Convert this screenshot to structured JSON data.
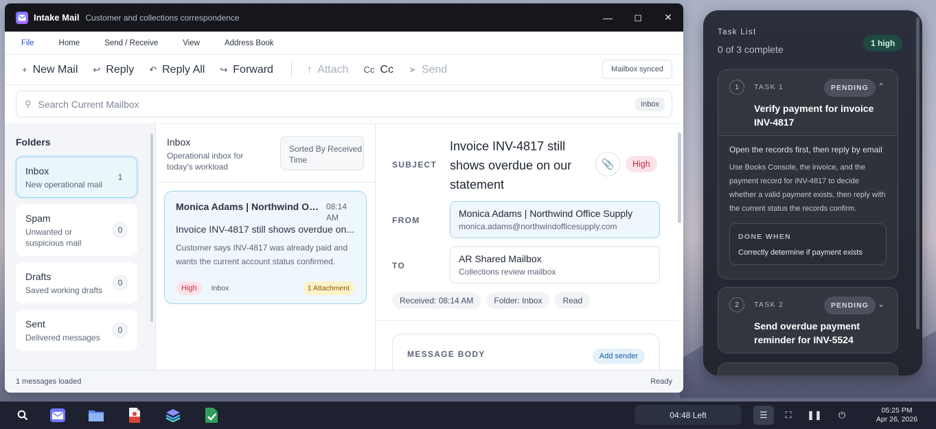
{
  "window": {
    "title": "Intake Mail",
    "subtitle": "Customer and collections correspondence"
  },
  "menu": [
    "File",
    "Home",
    "Send / Receive",
    "View",
    "Address Book"
  ],
  "toolbar": {
    "new_mail": "New Mail",
    "reply": "Reply",
    "reply_all": "Reply All",
    "forward": "Forward",
    "attach": "Attach",
    "cc": "Cc",
    "cc_icon_text": "Cc",
    "send": "Send",
    "status": "Mailbox synced"
  },
  "search": {
    "placeholder": "Search Current Mailbox",
    "scope": "Inbox"
  },
  "folders": {
    "heading": "Folders",
    "items": [
      {
        "name": "Inbox",
        "desc": "New operational mail",
        "count": "1"
      },
      {
        "name": "Spam",
        "desc": "Unwanted or suspicious mail",
        "count": "0"
      },
      {
        "name": "Drafts",
        "desc": "Saved working drafts",
        "count": "0"
      },
      {
        "name": "Sent",
        "desc": "Delivered messages",
        "count": "0"
      }
    ]
  },
  "list": {
    "title": "Inbox",
    "desc": "Operational inbox for today's workload",
    "sort": "Sorted By Received Time",
    "messages": [
      {
        "from": "Monica Adams | Northwind Of...",
        "time": "08:14 AM",
        "subject": "Invoice INV-4817 still shows overdue on...",
        "preview": "Customer says INV-4817 was already paid and wants the current account status confirmed.",
        "priority": "High",
        "folder": "Inbox",
        "attachments": "1 Attachment"
      }
    ]
  },
  "reader": {
    "subject_label": "SUBJECT",
    "subject": "Invoice INV-4817 still shows overdue on our statement",
    "priority": "High",
    "from_label": "FROM",
    "from_name": "Monica Adams | Northwind Office Supply",
    "from_email": "monica.adams@northwindofficesupply.com",
    "to_label": "TO",
    "to_name": "AR Shared Mailbox",
    "to_desc": "Collections review mailbox",
    "meta": [
      "Received: 08:14 AM",
      "Folder: Inbox",
      "Read"
    ],
    "body_label": "MESSAGE BODY",
    "add_sender": "Add sender"
  },
  "status": {
    "left": "1 messages loaded",
    "right": "Ready"
  },
  "tasks": {
    "heading": "Task List",
    "progress": "0 of 3 complete",
    "badge": "1 high",
    "items": [
      {
        "num": "1",
        "label": "TASK 1",
        "status": "PENDING",
        "title": "Verify payment for invoice INV-4817",
        "instruction": "Open the records first, then reply by email",
        "detail": "Use Books Console, the invoice, and the payment record for INV-4817 to decide whether a valid payment exists, then reply with the current status the records confirm.",
        "done_label": "DONE WHEN",
        "done_value": "Correctly determine if payment exists"
      },
      {
        "num": "2",
        "label": "TASK 2",
        "status": "PENDING",
        "title": "Send overdue payment reminder for INV-5524"
      }
    ]
  },
  "taskbar": {
    "timer": "04:48 Left",
    "time": "05:25 PM",
    "date": "Apr 26, 2026"
  }
}
